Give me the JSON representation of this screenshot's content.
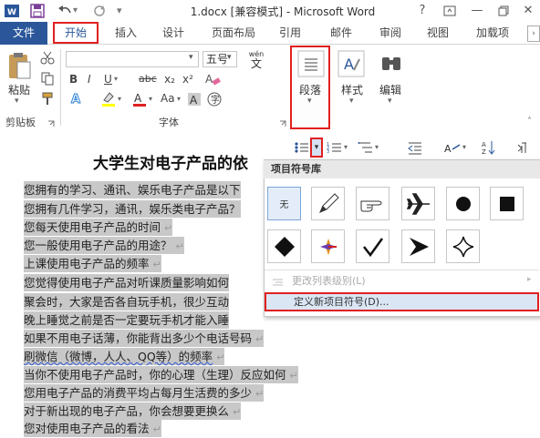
{
  "titlebar": {
    "title": "1.docx [兼容模式] - Microsoft Word",
    "help": "?",
    "minimize": "—",
    "close": "✕"
  },
  "tabs": {
    "file": "文件",
    "home": "开始",
    "insert": "插入",
    "design": "设计",
    "layout": "页面布局",
    "references": "引用",
    "mailings": "邮件",
    "review": "审阅",
    "view": "视图",
    "addins": "加载项"
  },
  "ribbon": {
    "clipboard": {
      "paste": "粘贴",
      "label": "剪贴板"
    },
    "font": {
      "size": "五号",
      "label": "字体",
      "aa": "Aa",
      "bold": "B",
      "italic": "I",
      "underline": "U",
      "strike": "abc",
      "sub": "x₂",
      "sup": "x²",
      "wen": "wén",
      "wen_char": "文"
    },
    "paragraph": {
      "label": "段落"
    },
    "styles": {
      "label": "样式"
    },
    "editing": {
      "label": "编辑"
    }
  },
  "document": {
    "title": "大学生对电子产品的依",
    "lines": [
      "您拥有的学习、通讯、娱乐电子产品是以下",
      "您拥有几件学习，通讯，娱乐类电子产品？",
      "您每天使用电子产品的时间",
      "您一般使用电子产品的用途？",
      "上课使用电子产品的频率",
      "您觉得使用电子产品对听课质量影响如何",
      "聚会时，大家是否各自玩手机，很少互动",
      "晚上睡觉之前是否一定要玩手机才能入睡",
      "如果不用电子话薄，你能背出多少个电话号码",
      "刷微信（微博，人人、QQ等）的频率",
      "当你不使用电子产品时，你的心理（生理）反应如何",
      "您用电子产品的消费平均占每月生活费的多少",
      "对于新出现的电子产品，你会想要更换么",
      "您对使用电子产品的看法"
    ],
    "para_mark": "↵"
  },
  "bullet_gallery": {
    "header": "项目符号库",
    "none_label": "无",
    "change_level": "更改列表级别(L)",
    "define_new": "定义新项目符号(D)..."
  }
}
